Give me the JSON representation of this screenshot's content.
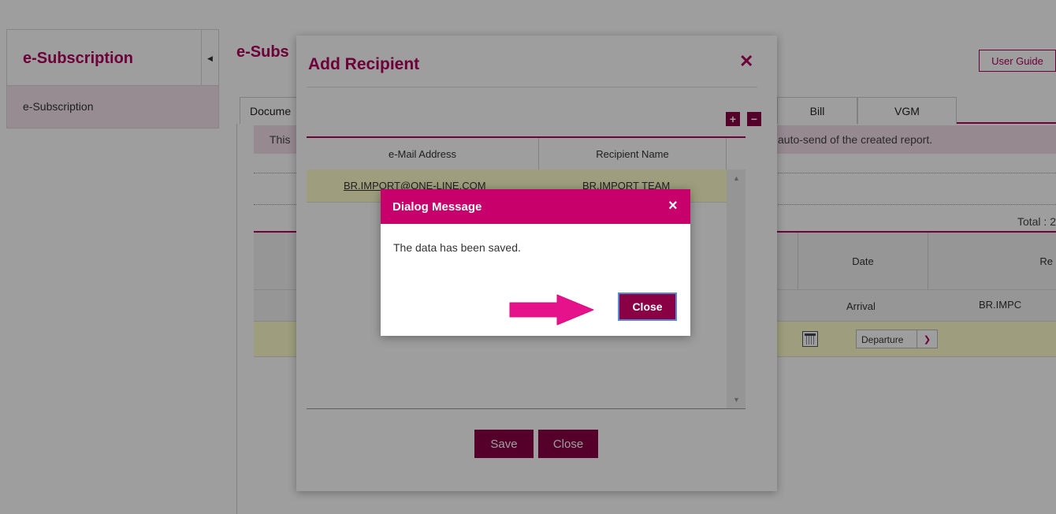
{
  "sidebar": {
    "title": "e-Subscription",
    "toggle_icon": "caret-left-icon",
    "items": [
      {
        "label": "e-Subscription"
      }
    ]
  },
  "main": {
    "title": "e-Subs",
    "user_guide_label": "User Guide",
    "tabs": [
      {
        "label": "Docume"
      },
      {
        "label": "Bill"
      },
      {
        "label": "VGM"
      }
    ],
    "notice_left": "This",
    "notice_right": "auto-send of the created report.",
    "total_label": "Total : 2",
    "grid": {
      "columns": [
        {
          "label": "Date"
        },
        {
          "label": "Re"
        }
      ],
      "row1": {
        "date": "Arrival",
        "recipient": "BR.IMPC"
      },
      "row2": {
        "date_select": "Departure"
      }
    }
  },
  "add_recipient": {
    "title": "Add Recipient",
    "close_icon": "close-icon",
    "add_icon": "plus-icon",
    "remove_icon": "minus-icon",
    "add_symbol": "+",
    "remove_symbol": "−",
    "columns": [
      {
        "label": "e-Mail Address"
      },
      {
        "label": "Recipient Name"
      }
    ],
    "rows": [
      {
        "email": "BR.IMPORT@ONE-LINE.COM",
        "name": "BR.IMPORT TEAM"
      }
    ],
    "save_label": "Save",
    "close_label": "Close"
  },
  "dialog": {
    "title": "Dialog Message",
    "close_icon": "close-icon",
    "close_symbol": "×",
    "message": "The data has been saved.",
    "close_label": "Close"
  },
  "annotation": {
    "arrow_icon": "arrow-right-icon",
    "arrow_color": "#e6128b"
  },
  "colors": {
    "brand": "#b0005c",
    "button": "#8a0044",
    "dialog_header": "#c8006b",
    "highlight_row": "#ffffcc"
  }
}
